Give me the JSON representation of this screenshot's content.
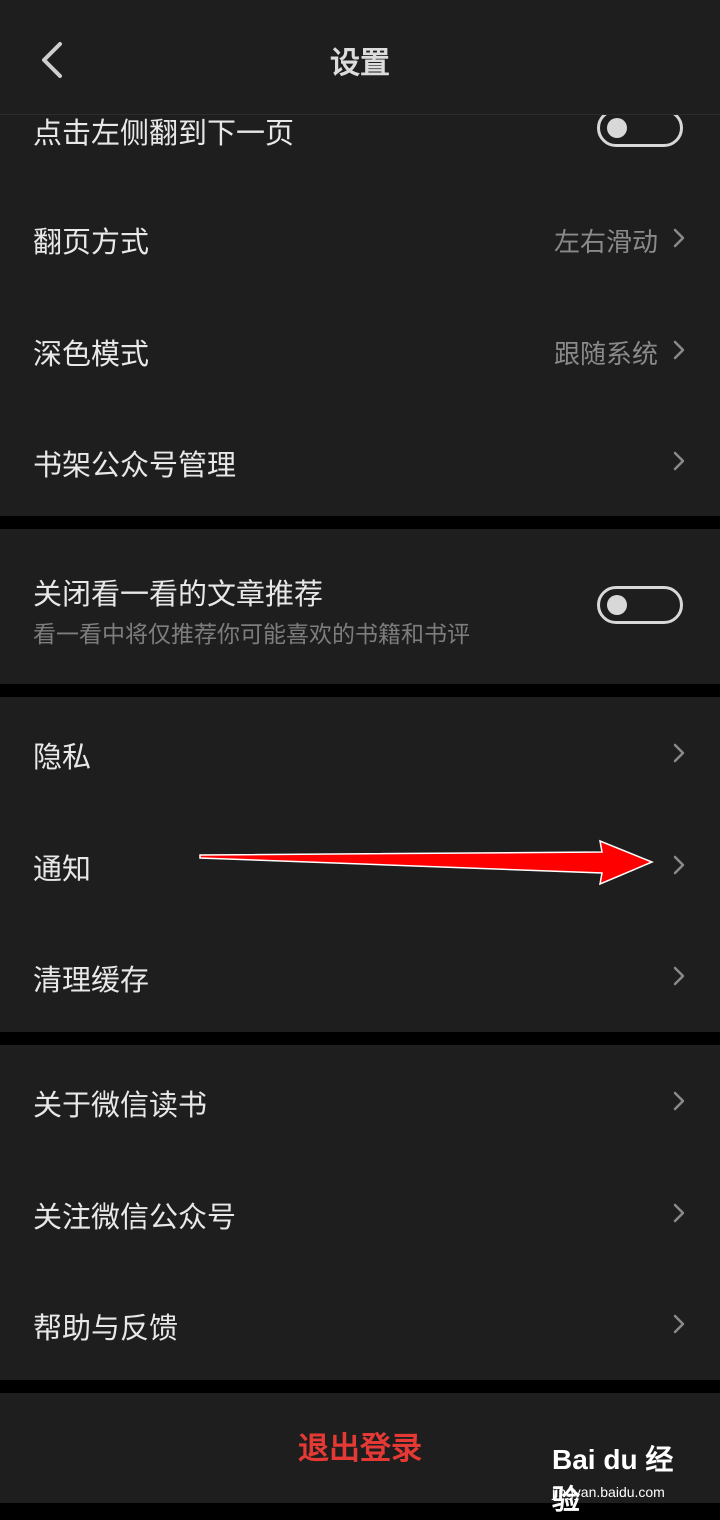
{
  "header": {
    "title": "设置"
  },
  "group1": {
    "items": [
      {
        "label": "点击左侧翻到下一页"
      },
      {
        "label": "翻页方式",
        "value": "左右滑动"
      },
      {
        "label": "深色模式",
        "value": "跟随系统"
      },
      {
        "label": "书架公众号管理"
      }
    ]
  },
  "group2": {
    "title": "关闭看一看的文章推荐",
    "subtitle": "看一看中将仅推荐你可能喜欢的书籍和书评"
  },
  "group3": {
    "items": [
      {
        "label": "隐私"
      },
      {
        "label": "通知"
      },
      {
        "label": "清理缓存"
      }
    ]
  },
  "group4": {
    "items": [
      {
        "label": "关于微信读书"
      },
      {
        "label": "关注微信公众号"
      },
      {
        "label": "帮助与反馈"
      }
    ]
  },
  "logout": {
    "label": "退出登录"
  },
  "watermark": {
    "brand": "Bai du 经验",
    "url": "jingyan.baidu.com"
  },
  "colors": {
    "logout": "#e53935",
    "annotation_arrow": "#ff0000"
  }
}
